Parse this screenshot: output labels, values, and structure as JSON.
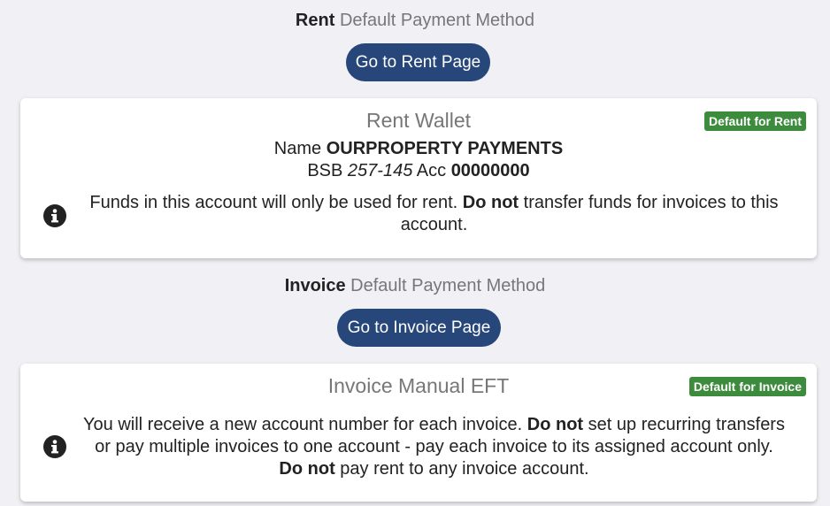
{
  "rent_section": {
    "heading_strong": "Rent",
    "heading_rest": "Default Payment Method",
    "button_label": "Go to Rent Page",
    "card": {
      "title": "Rent Wallet",
      "badge": "Default for Rent",
      "name_label": "Name",
      "name_value": "OURPROPERTY PAYMENTS",
      "bsb_label": "BSB",
      "bsb_value": "257-145",
      "acc_label": "Acc",
      "acc_value": "00000000",
      "message_part1": "Funds in this account will only be used for rent.",
      "message_bold1": "Do not",
      "message_part2": "transfer funds for invoices to this account."
    }
  },
  "invoice_section": {
    "heading_strong": "Invoice",
    "heading_rest": "Default Payment Method",
    "button_label": "Go to Invoice Page",
    "card": {
      "title": "Invoice Manual EFT",
      "badge": "Default for Invoice",
      "message_part1": "You will receive a new account number for each invoice.",
      "message_bold1": "Do not",
      "message_part2": "set up recurring transfers or pay multiple invoices to one account - pay each invoice to its assigned account only.",
      "message_bold2": "Do not",
      "message_part3": "pay rent to any invoice account."
    }
  },
  "colors": {
    "background": "#f0f0f5",
    "button": "#27467a",
    "badge": "#3d8b3d",
    "muted_text": "#777777"
  },
  "icons": {
    "info": "info-circle-icon"
  }
}
